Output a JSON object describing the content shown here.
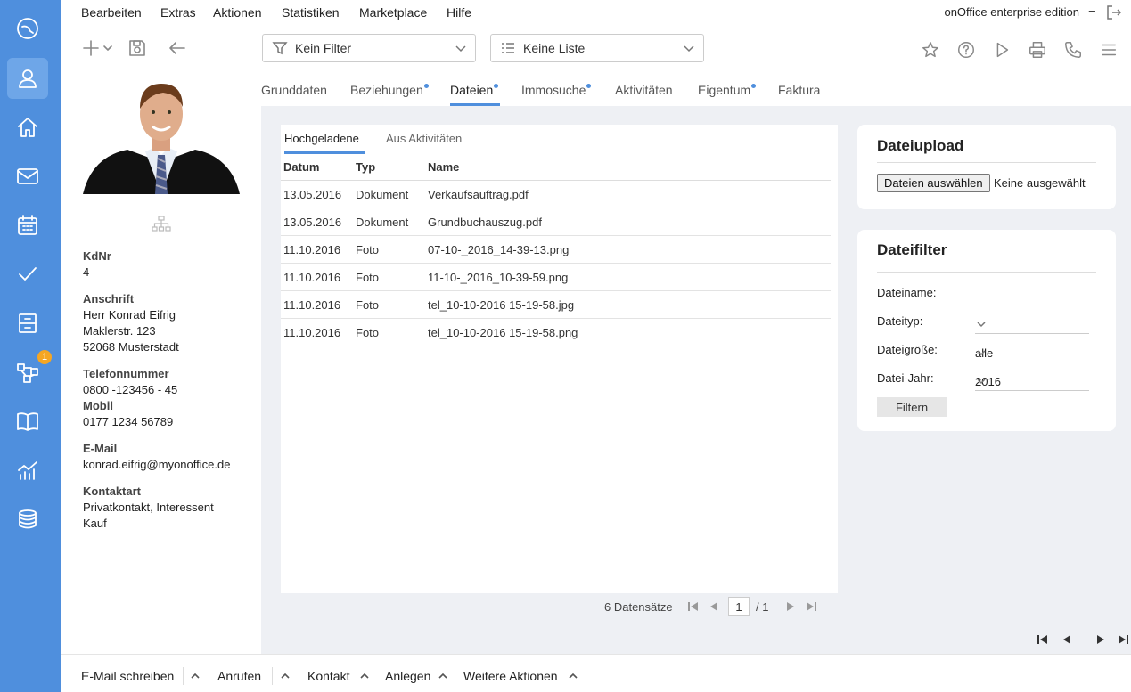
{
  "menu": {
    "items": [
      "Bearbeiten",
      "Extras",
      "Aktionen",
      "Statistiken",
      "Marketplace",
      "Hilfe"
    ],
    "edition": "onOffice enterprise edition",
    "minimize": "–"
  },
  "rail": {
    "badge_count": "1",
    "active_item": "address-icon",
    "icons": [
      "logo-icon",
      "address-icon",
      "home-icon",
      "mail-icon",
      "calendar-icon",
      "checkmark-icon",
      "archive-icon",
      "process-icon",
      "book-icon",
      "statistics-icon",
      "database-icon"
    ]
  },
  "toolbar": {
    "filter_label": "Kein Filter",
    "list_label": "Keine Liste"
  },
  "tabs": [
    {
      "label": "Grunddaten",
      "dot": false
    },
    {
      "label": "Beziehungen",
      "dot": true
    },
    {
      "label": "Dateien",
      "dot": true,
      "active": true
    },
    {
      "label": "Immosuche",
      "dot": true
    },
    {
      "label": "Aktivitäten",
      "dot": false
    },
    {
      "label": "Eigentum",
      "dot": true
    },
    {
      "label": "Faktura",
      "dot": false
    }
  ],
  "contact": {
    "kdnr_label": "KdNr",
    "kdnr": "4",
    "address_label": "Anschrift",
    "address_line1": "Herr Konrad Eifrig",
    "address_line2": "Maklerstr. 123",
    "address_line3": "52068 Musterstadt",
    "phone_label": "Telefonnummer",
    "phone": "0800 -123456 - 45",
    "mobile_label": "Mobil",
    "mobile": "0177 1234 56789",
    "email_label": "E-Mail",
    "email": "konrad.eifrig@myonoffice.de",
    "contact_type_label": "Kontaktart",
    "contact_type_line1": "Privatkontakt, Interessent",
    "contact_type_line2": "Kauf"
  },
  "files": {
    "subtabs": [
      "Hochgeladene",
      "Aus Aktivitäten"
    ],
    "columns": [
      "Datum",
      "Typ",
      "Name"
    ],
    "rows": [
      {
        "date": "13.05.2016",
        "type": "Dokument",
        "name": "Verkaufsauftrag.pdf"
      },
      {
        "date": "13.05.2016",
        "type": "Dokument",
        "name": "Grundbuchauszug.pdf"
      },
      {
        "date": "11.10.2016",
        "type": "Foto",
        "name": "07-10-_2016_14-39-13.png"
      },
      {
        "date": "11.10.2016",
        "type": "Foto",
        "name": "11-10-_2016_10-39-59.png"
      },
      {
        "date": "11.10.2016",
        "type": "Foto",
        "name": "tel_10-10-2016 15-19-58.jpg"
      },
      {
        "date": "11.10.2016",
        "type": "Foto",
        "name": "tel_10-10-2016 15-19-58.png"
      }
    ],
    "record_count": "6 Datensätze",
    "page": "1",
    "page_total": "/ 1"
  },
  "upload": {
    "title": "Dateiupload",
    "choose_label": "Dateien auswählen",
    "no_file": "Keine ausgewählt"
  },
  "filter": {
    "title": "Dateifilter",
    "name_label": "Dateiname:",
    "type_label": "Dateityp:",
    "type_value": "",
    "size_label": "Dateigröße:",
    "size_value": "alle",
    "year_label": "Datei-Jahr:",
    "year_value": "2016",
    "button": "Filtern"
  },
  "footer": [
    "E-Mail schreiben",
    "Anrufen",
    "Kontakt",
    "Anlegen",
    "Weitere Aktionen"
  ]
}
